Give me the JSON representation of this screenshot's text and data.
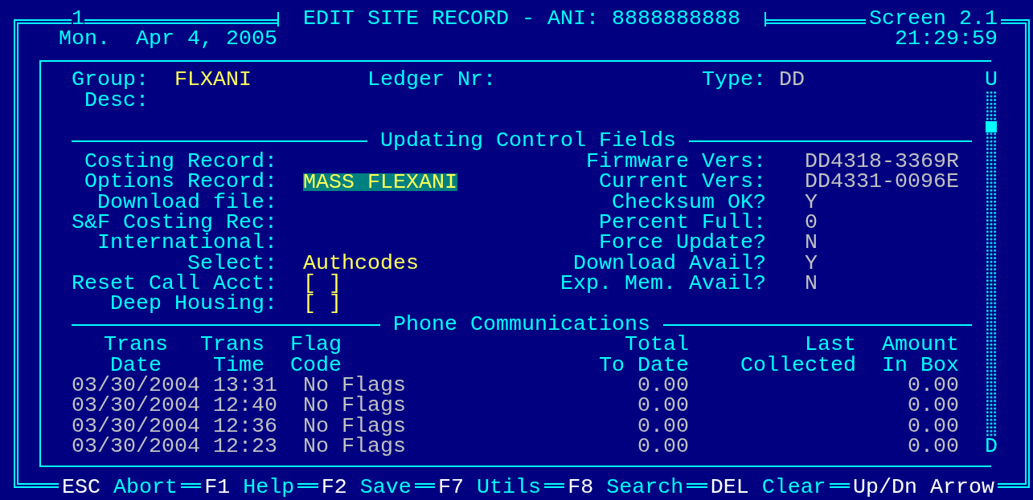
{
  "header": {
    "screen_number": "1",
    "title": "EDIT SITE RECORD - ANI: 8888888888",
    "screen_id": "Screen 2.1",
    "date": "Mon.  Apr 4, 2005",
    "time": "21:29:59"
  },
  "record": {
    "group_label": "Group:",
    "group_value": "FLXANI",
    "ledger_label": "Ledger Nr:",
    "type_label": "Type:",
    "type_value": "DD",
    "desc_label": "Desc:"
  },
  "control_section": {
    "title": "Updating Control Fields",
    "left_fields": [
      {
        "label": "Costing Record:",
        "kind": "blank"
      },
      {
        "label": "Options Record:",
        "kind": "text",
        "value": "MASS FLEXANI",
        "focused": true
      },
      {
        "label": "Download file:",
        "kind": "blank"
      },
      {
        "label": "S&F Costing Rec:",
        "kind": "blank"
      },
      {
        "label": "International:",
        "kind": "blank"
      },
      {
        "label": "Select:",
        "kind": "text",
        "value": "Authcodes",
        "focused": false
      },
      {
        "label": "Reset Call Acct:",
        "kind": "checkbox",
        "value": "[ ]",
        "checked": false
      },
      {
        "label": "Deep Housing:",
        "kind": "checkbox",
        "value": "[ ]",
        "checked": false
      }
    ],
    "right_fields": [
      {
        "label": "Firmware Vers:",
        "value": "DD4318-3369R"
      },
      {
        "label": "Current Vers:",
        "value": "DD4331-0096E"
      },
      {
        "label": "Checksum OK?",
        "value": "Y"
      },
      {
        "label": "Percent Full:",
        "value": "0"
      },
      {
        "label": "Force Update?",
        "value": "N"
      },
      {
        "label": "Download Avail?",
        "value": "Y"
      },
      {
        "label": "Exp. Mem. Avail?",
        "value": "N"
      }
    ]
  },
  "phone_section": {
    "title": "Phone Communications",
    "columns": [
      {
        "line1": "Trans",
        "line2": "Date"
      },
      {
        "line1": "Trans",
        "line2": "Time"
      },
      {
        "line1": "Flag",
        "line2": "Code"
      },
      {
        "line1": "Total",
        "line2": "To Date"
      },
      {
        "line1": "Last",
        "line2": "Collected"
      },
      {
        "line1": "Amount",
        "line2": "In Box"
      }
    ],
    "rows": [
      {
        "trans_date": "03/30/2004",
        "trans_time": "13:31",
        "flag_code": "No Flags",
        "total_to_date": "0.00",
        "amount_in_box": "0.00"
      },
      {
        "trans_date": "03/30/2004",
        "trans_time": "12:40",
        "flag_code": "No Flags",
        "total_to_date": "0.00",
        "amount_in_box": "0.00"
      },
      {
        "trans_date": "03/30/2004",
        "trans_time": "12:36",
        "flag_code": "No Flags",
        "total_to_date": "0.00",
        "amount_in_box": "0.00"
      },
      {
        "trans_date": "03/30/2004",
        "trans_time": "12:23",
        "flag_code": "No Flags",
        "total_to_date": "0.00",
        "amount_in_box": "0.00"
      }
    ]
  },
  "scrollbar": {
    "up": "U",
    "down": "D"
  },
  "footer_keys": [
    {
      "key": "ESC",
      "label": "Abort"
    },
    {
      "key": "F1",
      "label": "Help"
    },
    {
      "key": "F2",
      "label": "Save"
    },
    {
      "key": "F7",
      "label": "Utils"
    },
    {
      "key": "F8",
      "label": "Search"
    },
    {
      "key": "DEL",
      "label": "Clear"
    },
    {
      "key": "Up/Dn Arrow"
    }
  ]
}
